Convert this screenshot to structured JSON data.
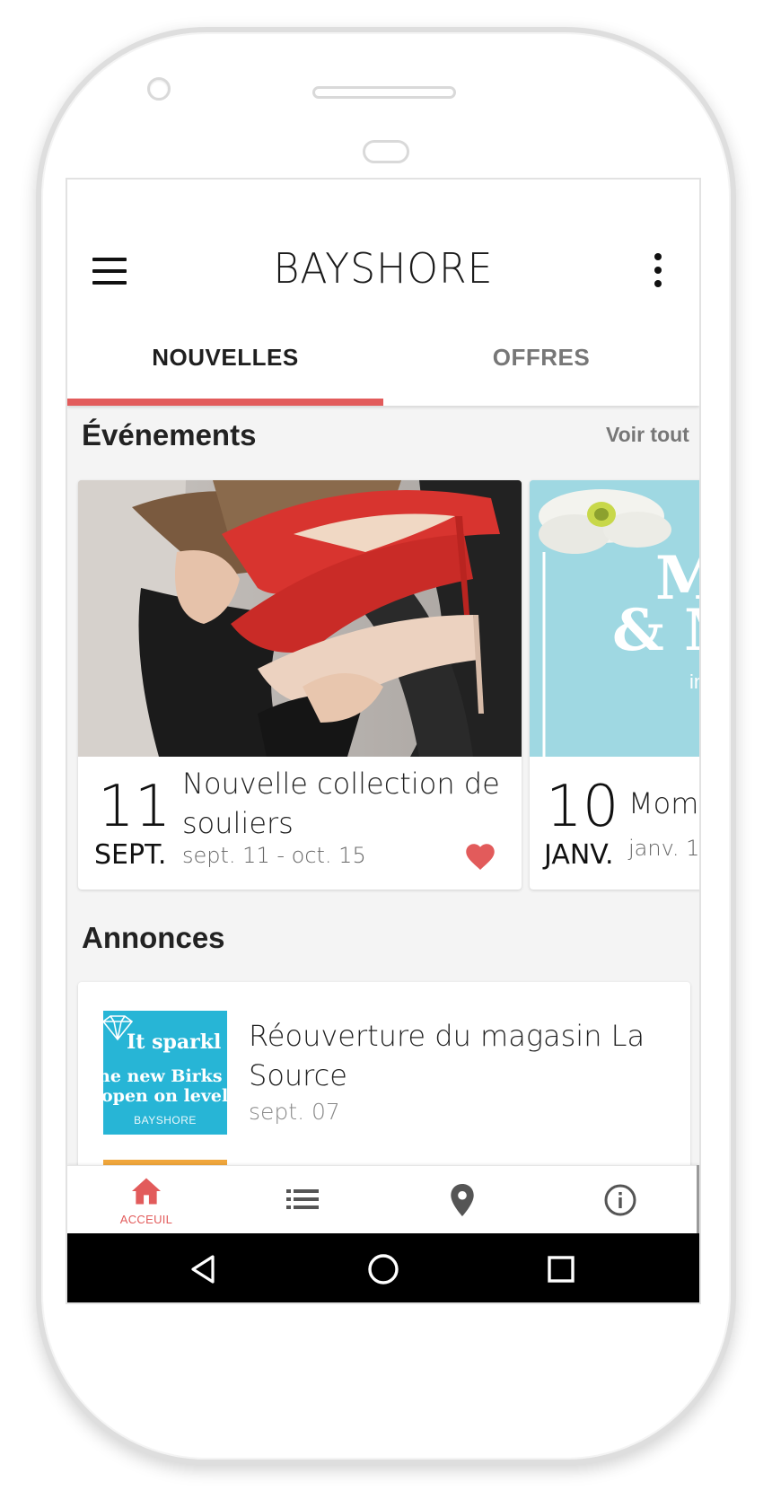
{
  "app": {
    "brand": "BAYSHORE"
  },
  "tabs": [
    {
      "label": "NOUVELLES",
      "active": true
    },
    {
      "label": "OFFRES",
      "active": false
    }
  ],
  "events": {
    "title": "Événements",
    "see_all": "Voir tout",
    "items": [
      {
        "day": "11",
        "month": "SEPT.",
        "title": "Nouvelle collection de souliers",
        "range": "sept. 11 - oct. 15",
        "favorited": true
      },
      {
        "day": "10",
        "month": "JANV.",
        "title": "Mom",
        "range": "janv. 1"
      }
    ]
  },
  "announcements": {
    "title": "Annonces",
    "items": [
      {
        "title": "Réouverture du magasin La Source",
        "date": "sept. 07",
        "thumb_lines": [
          "It sparkl",
          "ne new Birks",
          "open on level",
          "BAYSHORE"
        ]
      }
    ]
  },
  "bottom_nav": {
    "items": [
      {
        "label": "ACCEUIL",
        "icon": "home-icon",
        "active": true
      },
      {
        "icon": "list-icon"
      },
      {
        "icon": "location-pin-icon"
      },
      {
        "icon": "info-icon"
      }
    ]
  },
  "event2_poster": {
    "line1": "M",
    "line2": "& M",
    "line3": "in"
  },
  "colors": {
    "accent": "#e25b5b",
    "poster_blue": "#9fd8e2",
    "thumb_blue": "#27b5d6"
  }
}
